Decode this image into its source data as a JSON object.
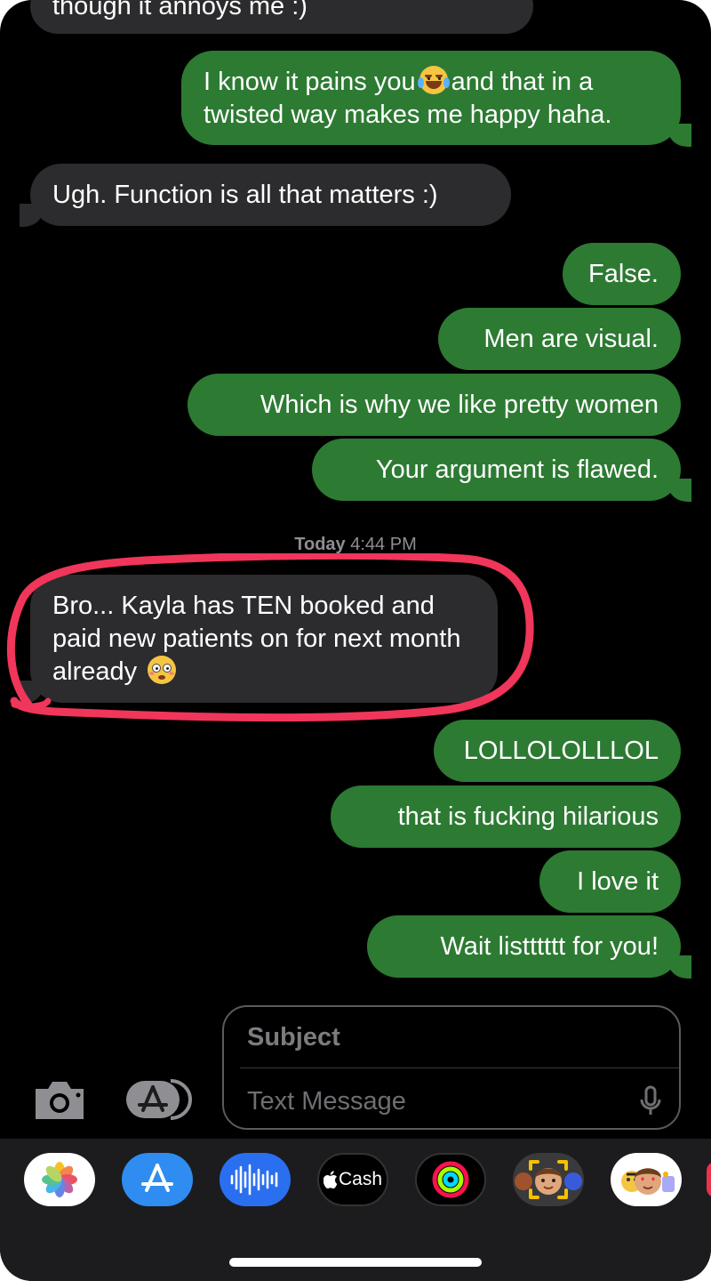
{
  "messages": [
    {
      "dir": "in",
      "text": "though it annoys me :)"
    },
    {
      "dir": "out",
      "line1a": "I know it pains you",
      "line1b": "and that in a",
      "line2": "twisted way makes me happy haha.",
      "emoji": "face-with-tears-of-joy"
    },
    {
      "dir": "in",
      "text": "Ugh. Function is all that matters :)"
    },
    {
      "dir": "out",
      "text": "False."
    },
    {
      "dir": "out",
      "text": "Men are visual."
    },
    {
      "dir": "out",
      "text": "Which is why we like pretty women"
    },
    {
      "dir": "out",
      "text": "Your argument is flawed."
    },
    {
      "dir": "in",
      "text": "Bro... Kayla has TEN booked and paid new patients on for next month already",
      "emoji": "flushed-face",
      "highlighted": true
    },
    {
      "dir": "out",
      "text": "LOLLOLOLLLOL"
    },
    {
      "dir": "out",
      "text": "that is fucking hilarious"
    },
    {
      "dir": "out",
      "text": "I love it"
    },
    {
      "dir": "out",
      "text": "Wait listttttt for you!"
    }
  ],
  "timestamp": {
    "day": "Today",
    "time": "4:44 PM"
  },
  "compose": {
    "subject_placeholder": "Subject",
    "message_placeholder": "Text Message"
  },
  "tray_apps": [
    {
      "name": "Photos",
      "icon": "photos-icon"
    },
    {
      "name": "App Store",
      "icon": "app-store-icon"
    },
    {
      "name": "Audio Message",
      "icon": "audio-waveform-icon"
    },
    {
      "name": "Apple Cash",
      "icon": "apple-cash-icon",
      "label": "Cash"
    },
    {
      "name": "Activity",
      "icon": "activity-rings-icon"
    },
    {
      "name": "Memoji",
      "icon": "memoji-icon"
    },
    {
      "name": "Memoji Stickers",
      "icon": "memoji-stickers-icon"
    }
  ],
  "colors": {
    "outgoing": "#2d7a33",
    "incoming": "#2c2c2e",
    "background": "#000000",
    "highlight": "#f0365a",
    "timestamp": "#8e8e93"
  }
}
